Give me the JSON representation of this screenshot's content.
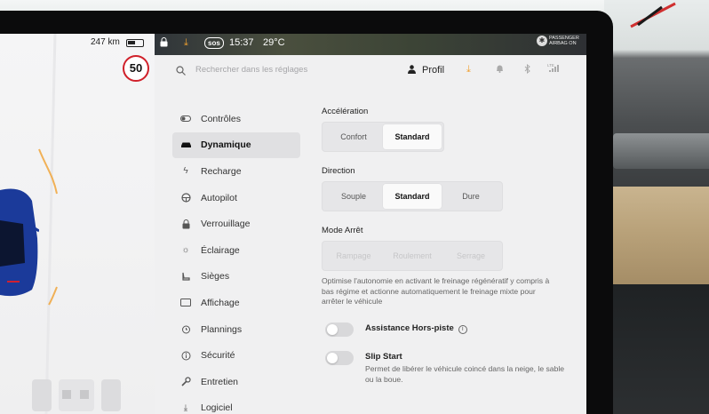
{
  "status_bar": {
    "lock_icon": "lock-icon",
    "download_icon": "download-icon",
    "sos": "sos",
    "time": "15:37",
    "temperature": "29°C",
    "airbag_line1": "PASSENGER",
    "airbag_line2": "AIRBAG ON",
    "airbag_icon": "passenger-airbag-icon"
  },
  "drive": {
    "range": "247 km",
    "speed_limit": "50"
  },
  "search": {
    "placeholder": "Rechercher dans les réglages"
  },
  "header": {
    "profile_label": "Profil",
    "icons": [
      "download-icon",
      "bell-icon",
      "bluetooth-icon",
      "lte-signal-icon"
    ],
    "lte": "LTE"
  },
  "nav": {
    "items": [
      {
        "label": "Contrôles",
        "icon": "toggle-icon"
      },
      {
        "label": "Dynamique",
        "icon": "car-icon"
      },
      {
        "label": "Recharge",
        "icon": "bolt-icon"
      },
      {
        "label": "Autopilot",
        "icon": "steering-wheel-icon"
      },
      {
        "label": "Verrouillage",
        "icon": "lock-icon"
      },
      {
        "label": "Éclairage",
        "icon": "sun-icon"
      },
      {
        "label": "Sièges",
        "icon": "seat-icon"
      },
      {
        "label": "Affichage",
        "icon": "display-icon"
      },
      {
        "label": "Plannings",
        "icon": "alarm-clock-icon"
      },
      {
        "label": "Sécurité",
        "icon": "info-circle-icon"
      },
      {
        "label": "Entretien",
        "icon": "wrench-icon"
      },
      {
        "label": "Logiciel",
        "icon": "download-icon"
      }
    ],
    "active_index": 1
  },
  "acceleration": {
    "label": "Accélération",
    "options": [
      "Confort",
      "Standard"
    ],
    "selected": "Standard"
  },
  "direction": {
    "label": "Direction",
    "options": [
      "Souple",
      "Standard",
      "Dure"
    ],
    "selected": "Standard"
  },
  "stop_mode": {
    "label": "Mode Arrêt",
    "options": [
      "Rampage",
      "Roulement",
      "Serrage"
    ],
    "selected": "",
    "description": "Optimise l'autonomie en activant le freinage régénératif y compris à bas régime et actionne automatiquement le freinage mixte pour arrêter le véhicule"
  },
  "offroad": {
    "title": "Assistance Hors-piste",
    "enabled": false
  },
  "slip_start": {
    "title": "Slip Start",
    "description": "Permet de libérer le véhicule coincé dans la neige, le sable ou la boue.",
    "enabled": false
  },
  "colors": {
    "accent_orange": "#f0a030",
    "speed_limit_red": "#d0202a",
    "panel_bg": "#f0f0f1"
  }
}
